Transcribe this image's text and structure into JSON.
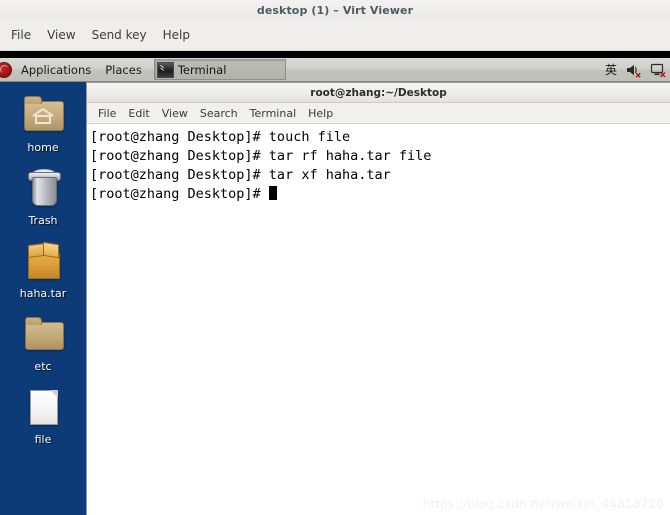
{
  "virt_viewer": {
    "title": "desktop (1) – Virt Viewer",
    "menu": [
      {
        "label": "File",
        "name": "vv-menu-file"
      },
      {
        "label": "View",
        "name": "vv-menu-view"
      },
      {
        "label": "Send key",
        "name": "vv-menu-send-key"
      },
      {
        "label": "Help",
        "name": "vv-menu-help"
      }
    ]
  },
  "panel": {
    "logo_icon": "redhat-logo-icon",
    "applications": "Applications",
    "places": "Places",
    "window_button": {
      "label": "Terminal",
      "icon": "terminal-icon"
    },
    "tray": {
      "ime": "英",
      "volume_icon": "volume-muted-icon",
      "display_icon": "display-disconnected-icon"
    }
  },
  "desktop": {
    "background_color": "#0d3b78",
    "icons": [
      {
        "label": "home",
        "icon": "home-folder-icon"
      },
      {
        "label": "Trash",
        "icon": "trash-icon"
      },
      {
        "label": "haha.tar",
        "icon": "archive-icon"
      },
      {
        "label": "etc",
        "icon": "folder-icon"
      },
      {
        "label": "file",
        "icon": "document-icon"
      }
    ]
  },
  "terminal": {
    "title": "root@zhang:~/Desktop",
    "menu": [
      {
        "label": "File",
        "name": "term-menu-file"
      },
      {
        "label": "Edit",
        "name": "term-menu-edit"
      },
      {
        "label": "View",
        "name": "term-menu-view"
      },
      {
        "label": "Search",
        "name": "term-menu-search"
      },
      {
        "label": "Terminal",
        "name": "term-menu-terminal"
      },
      {
        "label": "Help",
        "name": "term-menu-help"
      }
    ],
    "prompt": "[root@zhang Desktop]# ",
    "lines": [
      "[root@zhang Desktop]# touch file",
      "[root@zhang Desktop]# tar rf haha.tar file",
      "[root@zhang Desktop]# tar xf haha.tar"
    ],
    "current_line": "[root@zhang Desktop]# "
  },
  "watermark": "https://blog.csdn.net/weixin_44818720"
}
